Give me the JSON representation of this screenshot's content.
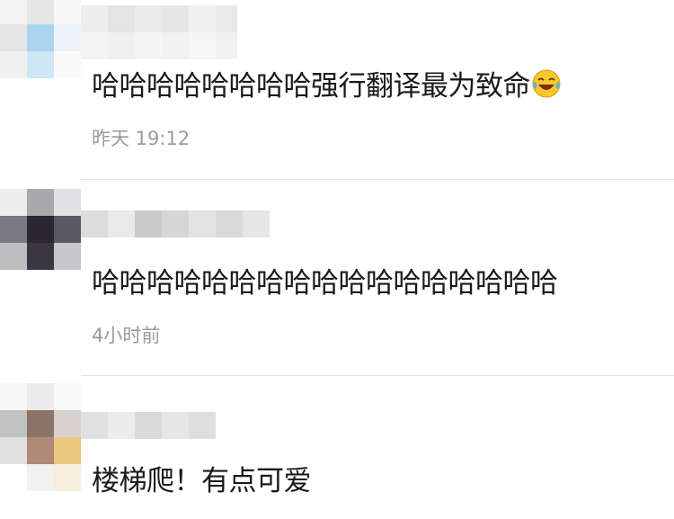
{
  "comments": [
    {
      "text": "哈哈哈哈哈哈哈哈强行翻译最为致命",
      "emoji": "laughing-tears-emoji",
      "time": "昨天 19:12"
    },
    {
      "text": "哈哈哈哈哈哈哈哈哈哈哈哈哈哈哈哈哈",
      "time": "4小时前"
    },
    {
      "text": "楼梯爬！有点可爱"
    }
  ],
  "colors": {
    "text": "#1a1a1a",
    "time": "#9b9b9b",
    "divider": "#e3e3e3",
    "emoji_face": "#f7c72c"
  }
}
